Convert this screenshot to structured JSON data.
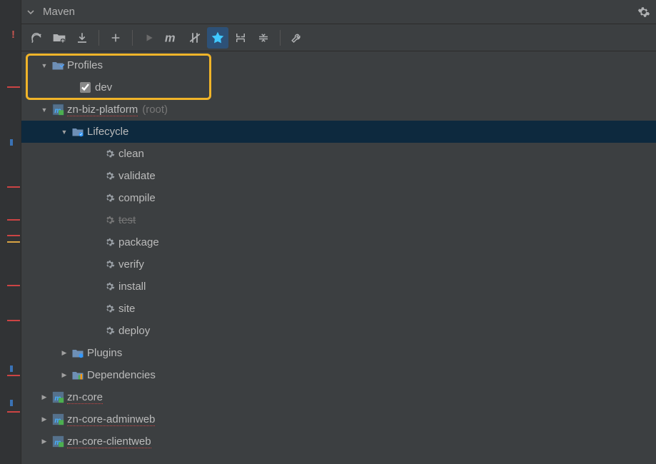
{
  "panel": {
    "title": "Maven"
  },
  "toolbar": {
    "refresh": "Refresh",
    "generate": "Generate Sources",
    "download": "Download Sources",
    "add": "Add",
    "run": "Run",
    "m": "Execute Maven Goal",
    "offline": "Toggle Offline",
    "skip": "Toggle Skip Tests",
    "collapse": "Collapse All",
    "showdeps": "Show Dependencies",
    "wrench": "Settings"
  },
  "tree": {
    "profiles": {
      "label": "Profiles"
    },
    "dev": {
      "label": "dev",
      "checked": true
    },
    "root": {
      "label": "zn-biz-platform",
      "suffix": "(root)"
    },
    "lifecycle": {
      "label": "Lifecycle"
    },
    "phases": {
      "clean": "clean",
      "validate": "validate",
      "compile": "compile",
      "test": "test",
      "package": "package",
      "verify": "verify",
      "install": "install",
      "site": "site",
      "deploy": "deploy"
    },
    "plugins": {
      "label": "Plugins"
    },
    "dependencies": {
      "label": "Dependencies"
    },
    "zn_core": {
      "label": "zn-core"
    },
    "zn_core_adminweb": {
      "label": "zn-core-adminweb"
    },
    "zn_core_clientweb": {
      "label": "zn-core-clientweb"
    }
  }
}
